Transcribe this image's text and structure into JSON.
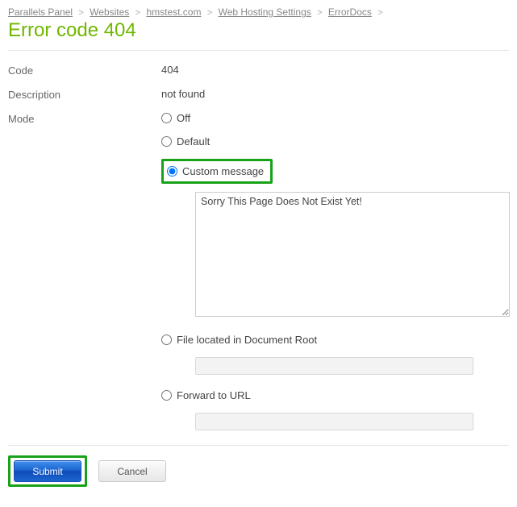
{
  "breadcrumb": [
    {
      "label": "Parallels Panel"
    },
    {
      "label": "Websites"
    },
    {
      "label": "hmstest.com"
    },
    {
      "label": "Web Hosting Settings"
    },
    {
      "label": "ErrorDocs"
    }
  ],
  "page_title": "Error code 404",
  "fields": {
    "code_label": "Code",
    "code_value": "404",
    "description_label": "Description",
    "description_value": "not found",
    "mode_label": "Mode"
  },
  "mode_options": {
    "off": "Off",
    "default": "Default",
    "custom": "Custom message",
    "file": "File located in Document Root",
    "forward": "Forward to URL",
    "selected": "custom"
  },
  "custom_message_value": "Sorry This Page Does Not Exist Yet!",
  "file_path_value": "",
  "forward_url_value": "",
  "buttons": {
    "submit": "Submit",
    "cancel": "Cancel"
  }
}
